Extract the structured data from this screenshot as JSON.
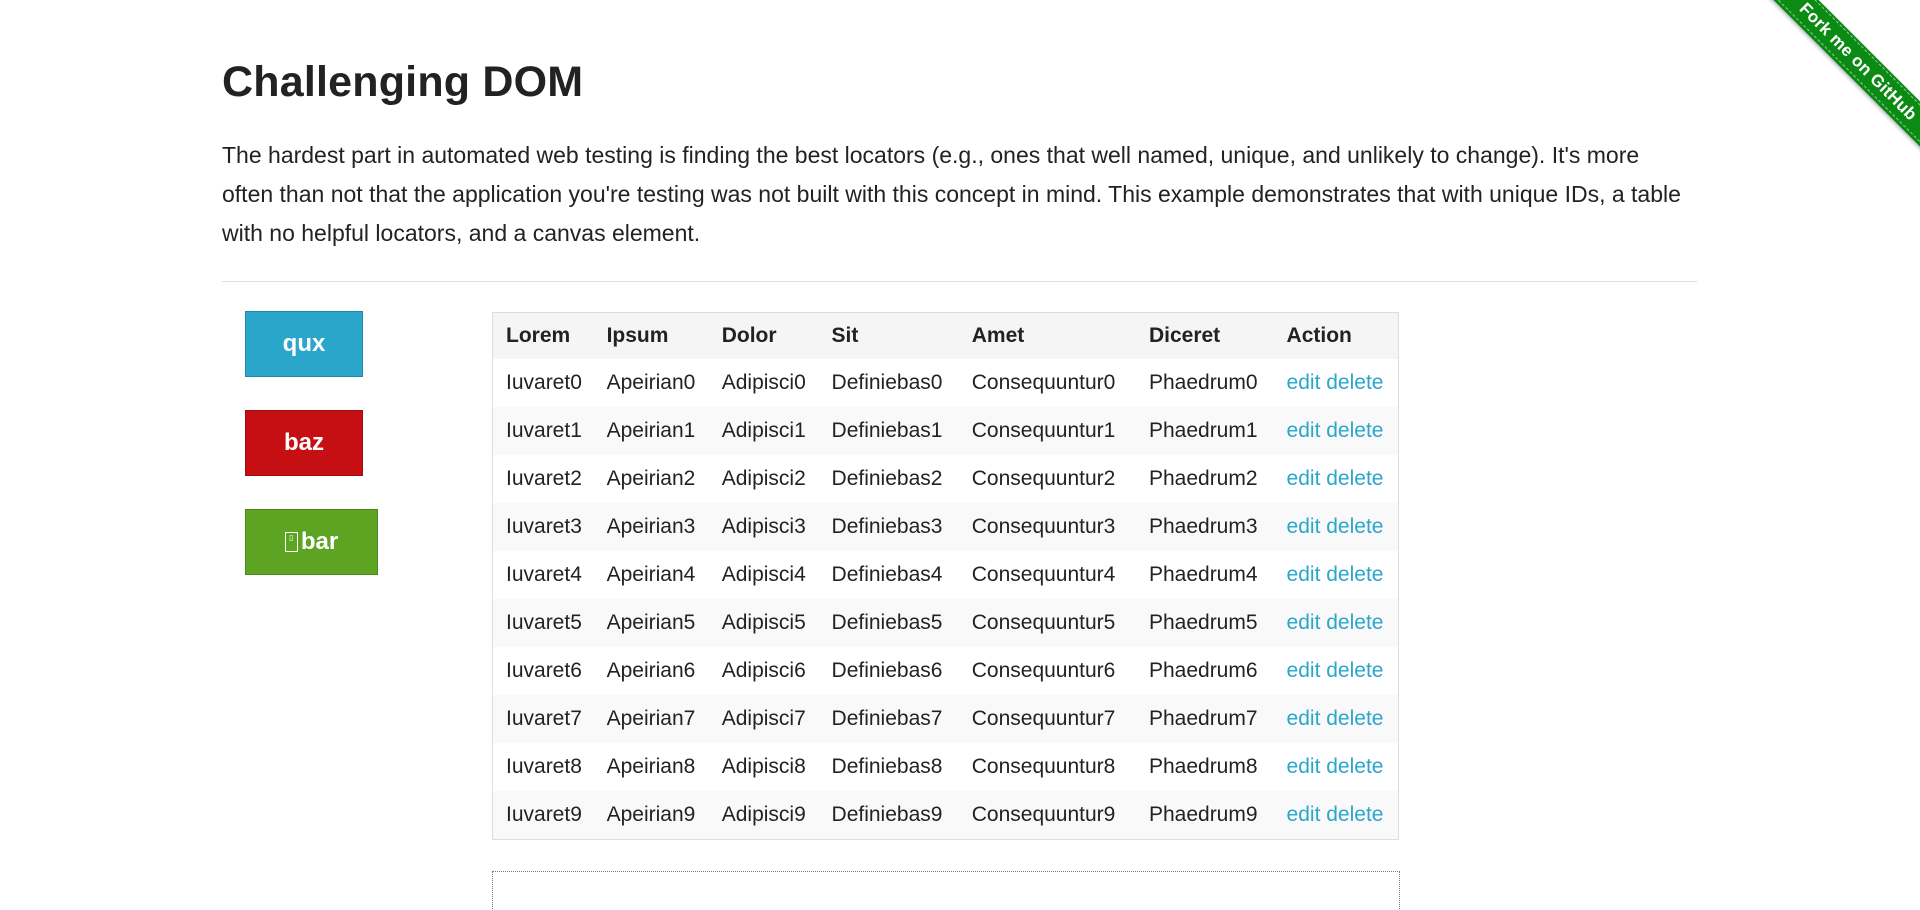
{
  "ribbon": {
    "label": "Fork me on GitHub"
  },
  "page": {
    "title": "Challenging DOM",
    "intro": "The hardest part in automated web testing is finding the best locators (e.g., ones that well named, unique, and unlikely to change). It's more often than not that the application you're testing was not built with this concept in mind. This example demonstrates that with unique IDs, a table with no helpful locators, and a canvas element."
  },
  "buttons": [
    {
      "label": "qux",
      "color": "#2ba6cb"
    },
    {
      "label": "baz",
      "color": "#c60f13"
    },
    {
      "label": "bar",
      "color": "#5da423",
      "glyph": "missing-glyph-icon"
    }
  ],
  "table": {
    "headers": [
      "Lorem",
      "Ipsum",
      "Dolor",
      "Sit",
      "Amet",
      "Diceret",
      "Action"
    ],
    "rows": [
      [
        "Iuvaret0",
        "Apeirian0",
        "Adipisci0",
        "Definiebas0",
        "Consequuntur0",
        "Phaedrum0"
      ],
      [
        "Iuvaret1",
        "Apeirian1",
        "Adipisci1",
        "Definiebas1",
        "Consequuntur1",
        "Phaedrum1"
      ],
      [
        "Iuvaret2",
        "Apeirian2",
        "Adipisci2",
        "Definiebas2",
        "Consequuntur2",
        "Phaedrum2"
      ],
      [
        "Iuvaret3",
        "Apeirian3",
        "Adipisci3",
        "Definiebas3",
        "Consequuntur3",
        "Phaedrum3"
      ],
      [
        "Iuvaret4",
        "Apeirian4",
        "Adipisci4",
        "Definiebas4",
        "Consequuntur4",
        "Phaedrum4"
      ],
      [
        "Iuvaret5",
        "Apeirian5",
        "Adipisci5",
        "Definiebas5",
        "Consequuntur5",
        "Phaedrum5"
      ],
      [
        "Iuvaret6",
        "Apeirian6",
        "Adipisci6",
        "Definiebas6",
        "Consequuntur6",
        "Phaedrum6"
      ],
      [
        "Iuvaret7",
        "Apeirian7",
        "Adipisci7",
        "Definiebas7",
        "Consequuntur7",
        "Phaedrum7"
      ],
      [
        "Iuvaret8",
        "Apeirian8",
        "Adipisci8",
        "Definiebas8",
        "Consequuntur8",
        "Phaedrum8"
      ],
      [
        "Iuvaret9",
        "Apeirian9",
        "Adipisci9",
        "Definiebas9",
        "Consequuntur9",
        "Phaedrum9"
      ]
    ],
    "actions": {
      "edit": "edit",
      "delete": "delete"
    }
  },
  "colors": {
    "link": "#2ba6cb",
    "ribbon": "#0b8a14"
  }
}
